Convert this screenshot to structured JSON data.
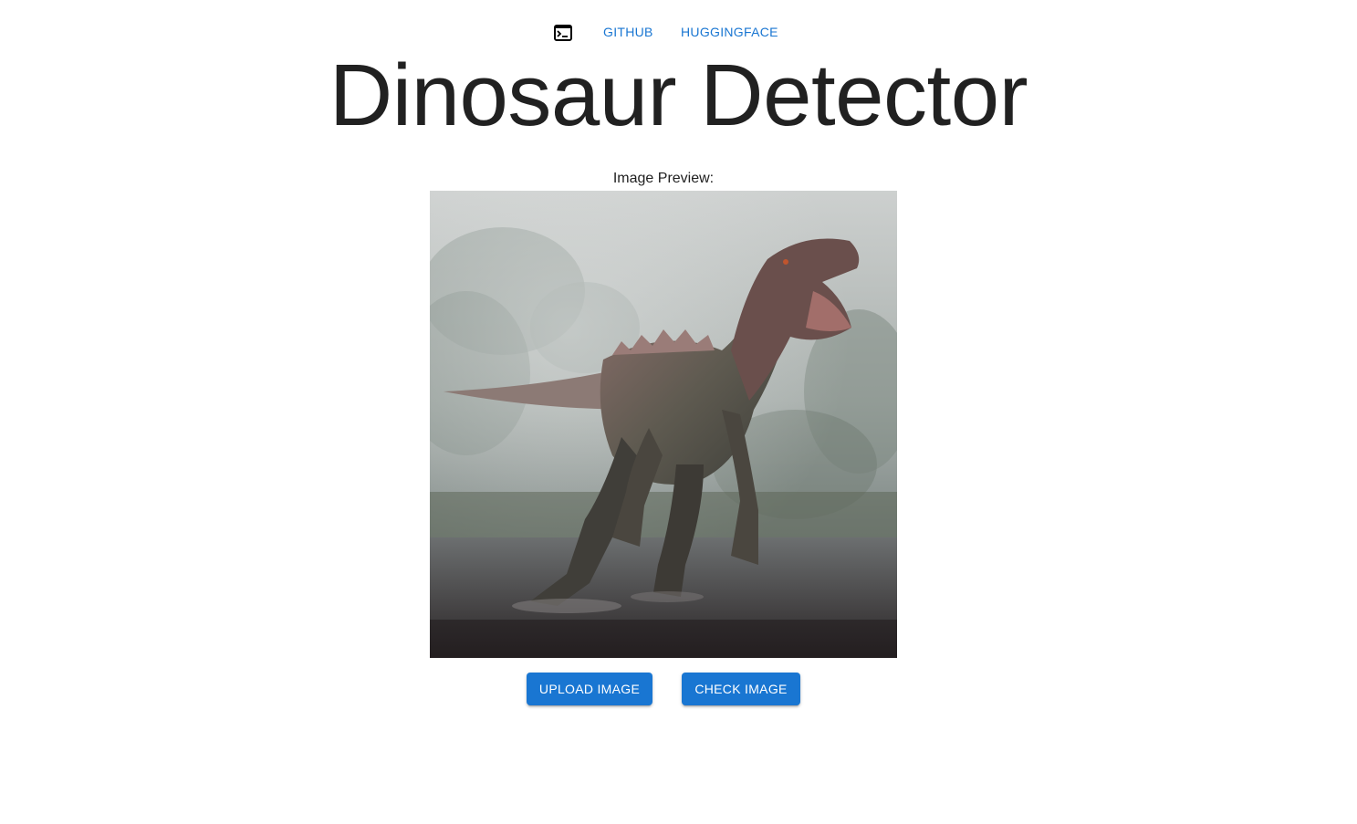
{
  "nav": {
    "terminal_icon": "terminal-icon",
    "links": [
      {
        "label": "GITHUB"
      },
      {
        "label": "HUGGINGFACE"
      }
    ]
  },
  "title": "Dinosaur Detector",
  "preview": {
    "label": "Image Preview:",
    "image_alt": "dinosaur-image"
  },
  "buttons": {
    "upload": "UPLOAD IMAGE",
    "check": "CHECK IMAGE"
  },
  "colors": {
    "accent": "#1976d2",
    "text": "#212121"
  }
}
